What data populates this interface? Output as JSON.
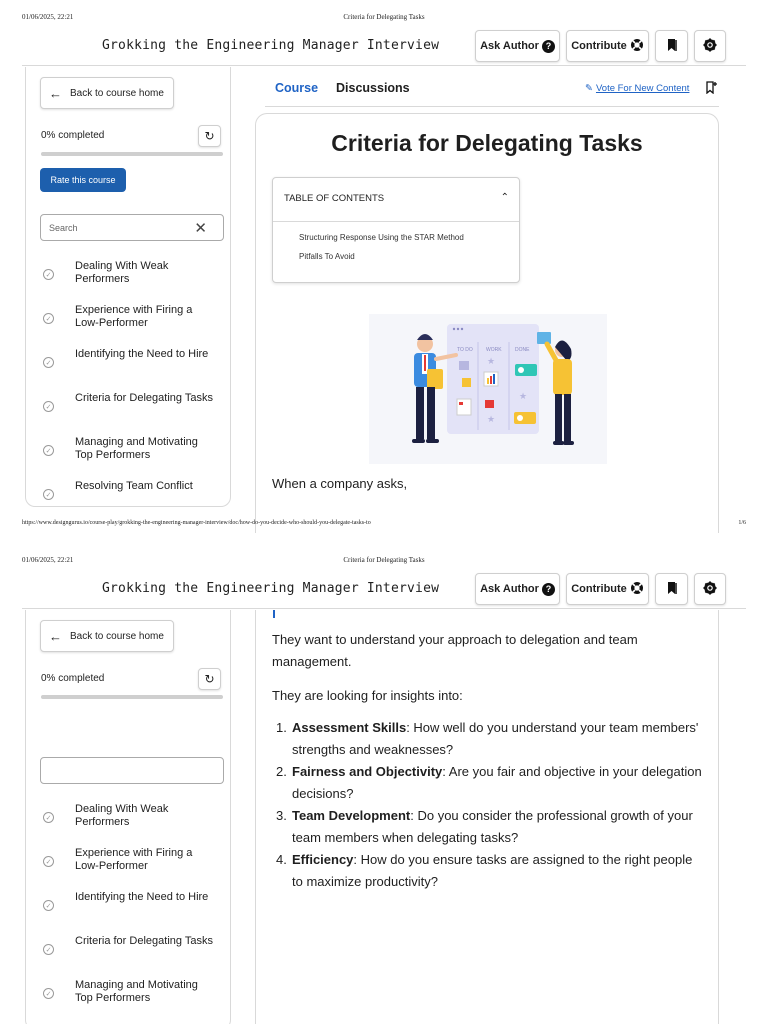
{
  "print": {
    "date": "01/06/2025, 22:21",
    "title": "Criteria for Delegating Tasks",
    "url": "https://www.designgurus.io/course-play/grokking-the-engineering-manager-interview/doc/how-do-you-decide-who-should-you-delegate-tasks-to",
    "page": "1/6"
  },
  "topbar": {
    "course_name": "Grokking the Engineering Manager Interview",
    "ask_author": "Ask Author",
    "contribute": "Contribute"
  },
  "sidebar": {
    "back_label": "Back to course home",
    "progress_label": "0% completed",
    "progress_fraction": 0,
    "rate_label": "Rate this course",
    "search_placeholder": "Search",
    "lessons": [
      "Dealing With Weak Performers",
      "Experience with Firing a Low-Performer",
      "Identifying the Need to Hire",
      "Criteria for Delegating Tasks",
      "Managing and Motivating Top Performers",
      "Resolving Team Conflict"
    ]
  },
  "tabs": {
    "course": "Course",
    "discussions": "Discussions",
    "vote": "Vote For New Content"
  },
  "article": {
    "title": "Criteria for Delegating Tasks",
    "toc_label": "TABLE OF CONTENTS",
    "toc_items": [
      "Structuring Response Using the STAR Method",
      "Pitfalls To Avoid"
    ],
    "board_columns": [
      "TO DO",
      "WORK",
      "DONE"
    ],
    "intro": "When a company asks,",
    "para1": "They want to understand your approach to delegation and team management.",
    "para2": "They are looking for insights into:",
    "list": [
      {
        "num": "1.",
        "bold": "Assessment Skills",
        "text": ": How well do you understand your team members' strengths and weaknesses?"
      },
      {
        "num": "2.",
        "bold": "Fairness and Objectivity",
        "text": ": Are you fair and objective in your delegation decisions?"
      },
      {
        "num": "3.",
        "bold": "Team Development",
        "text": ": Do you consider the professional growth of your team members when delegating tasks?"
      },
      {
        "num": "4.",
        "bold": "Efficiency",
        "text": ": How do you ensure tasks are assigned to the right people to maximize productivity?"
      }
    ]
  },
  "colors": {
    "accent": "#1f63c5",
    "rate_button": "#1d5fad"
  },
  "icons": {
    "back": "arrow-left-icon",
    "reset": "reset-icon",
    "clear": "close-icon",
    "check": "check-circle-icon",
    "help": "question-icon",
    "contribute": "lifebuoy-icon",
    "bookmark": "bookmark-icon",
    "settings": "gear-icon",
    "vote": "vote-icon",
    "flag": "bookmark-add-icon",
    "chevron": "chevron-up-icon"
  }
}
